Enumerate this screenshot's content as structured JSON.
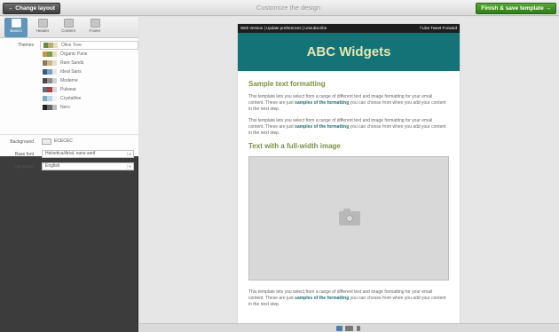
{
  "topbar": {
    "change_layout": "← Change layout",
    "title": "Customize the design",
    "finish": "Finish & save template →"
  },
  "tabs": [
    {
      "label": "Basics",
      "icon": "tools-icon"
    },
    {
      "label": "Header",
      "icon": "header-icon"
    },
    {
      "label": "Content",
      "icon": "content-icon"
    },
    {
      "label": "Footer",
      "icon": "footer-icon"
    }
  ],
  "themes": {
    "label": "Themes",
    "items": [
      {
        "name": "Olive Tree",
        "colors": [
          "#6f8b3a",
          "#b9b36a",
          "#e6e0b8"
        ]
      },
      {
        "name": "Organic Pane",
        "colors": [
          "#c99745",
          "#7f9b4b",
          "#e9dcb3"
        ]
      },
      {
        "name": "Rare Sands",
        "colors": [
          "#8d7a5a",
          "#c9b68c",
          "#e8dfc9"
        ]
      },
      {
        "name": "Ideal Sans",
        "colors": [
          "#3c5b7a",
          "#7da0bd",
          "#dfe8f0"
        ]
      },
      {
        "name": "Moderne",
        "colors": [
          "#4a4a4a",
          "#8d8d8d",
          "#d0d0d0"
        ]
      },
      {
        "name": "Pulwear",
        "colors": [
          "#5b6d80",
          "#b53b3b",
          "#d8d8d8"
        ]
      },
      {
        "name": "Crystalline",
        "colors": [
          "#87a9bf",
          "#c0d5e2",
          "#eef4f8"
        ]
      },
      {
        "name": "Nero",
        "colors": [
          "#222222",
          "#6a6a6a",
          "#bdbdbd"
        ]
      }
    ],
    "selected_index": 0
  },
  "background": {
    "label": "Background",
    "value": "ECECEC",
    "color": "#ececec"
  },
  "basefont": {
    "label": "Base font",
    "value": "Helvetica/Arial, sans-serif"
  },
  "language": {
    "label": "Language",
    "value": "English"
  },
  "email": {
    "preheader_links": "Web Version | Update preferences | Unsubscribe",
    "social": "f Like   Tweet   Forward",
    "banner_title": "ABC Widgets",
    "banner_color": "#147376",
    "heading1": "Sample text formatting",
    "para_start": "This template lets you select from a range of different text and image formatting for your email content. These are just ",
    "para_bold": "samples of the formatting",
    "para_end": " you can choose from when you add your content in the next step.",
    "heading2": "Text with a full-width image"
  }
}
